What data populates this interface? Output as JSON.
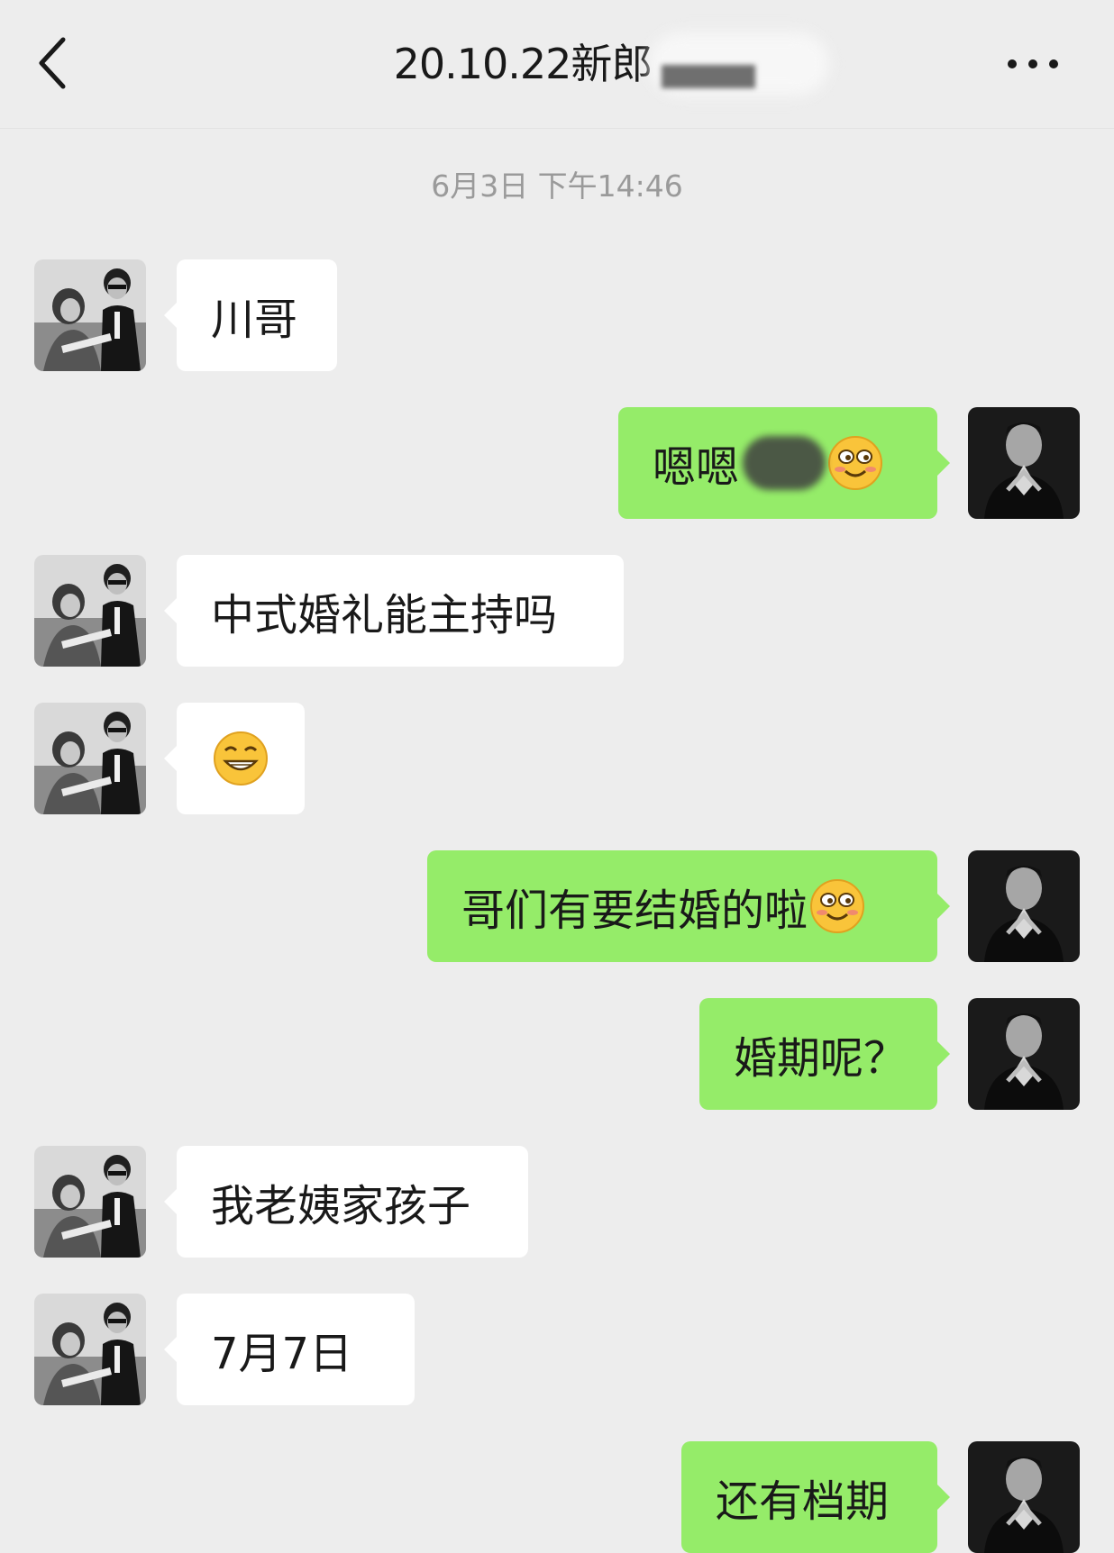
{
  "header": {
    "title": "20.10.22新郎",
    "back_icon": "chevron-left-icon",
    "more_icon": "ellipsis-icon"
  },
  "timestamp": "6月3日 下午14:46",
  "messages": [
    {
      "side": "in",
      "text": "川哥"
    },
    {
      "side": "out",
      "text": "嗯嗯",
      "emoji": "smile-blush-emoji"
    },
    {
      "side": "in",
      "text": "中式婚礼能主持吗"
    },
    {
      "side": "in",
      "text": "",
      "emoji": "grin-emoji"
    },
    {
      "side": "out",
      "text": "哥们有要结婚的啦",
      "emoji": "smile-blush-emoji"
    },
    {
      "side": "out",
      "text": "婚期呢？"
    },
    {
      "side": "in",
      "text": "我老姨家孩子"
    },
    {
      "side": "in",
      "text": "7月7日"
    },
    {
      "side": "out",
      "text": "还有档期"
    }
  ],
  "colors": {
    "background": "#ededed",
    "incoming_bubble": "#ffffff",
    "outgoing_bubble": "#95ec69",
    "text": "#191919",
    "timestamp": "#9a9a9a"
  }
}
